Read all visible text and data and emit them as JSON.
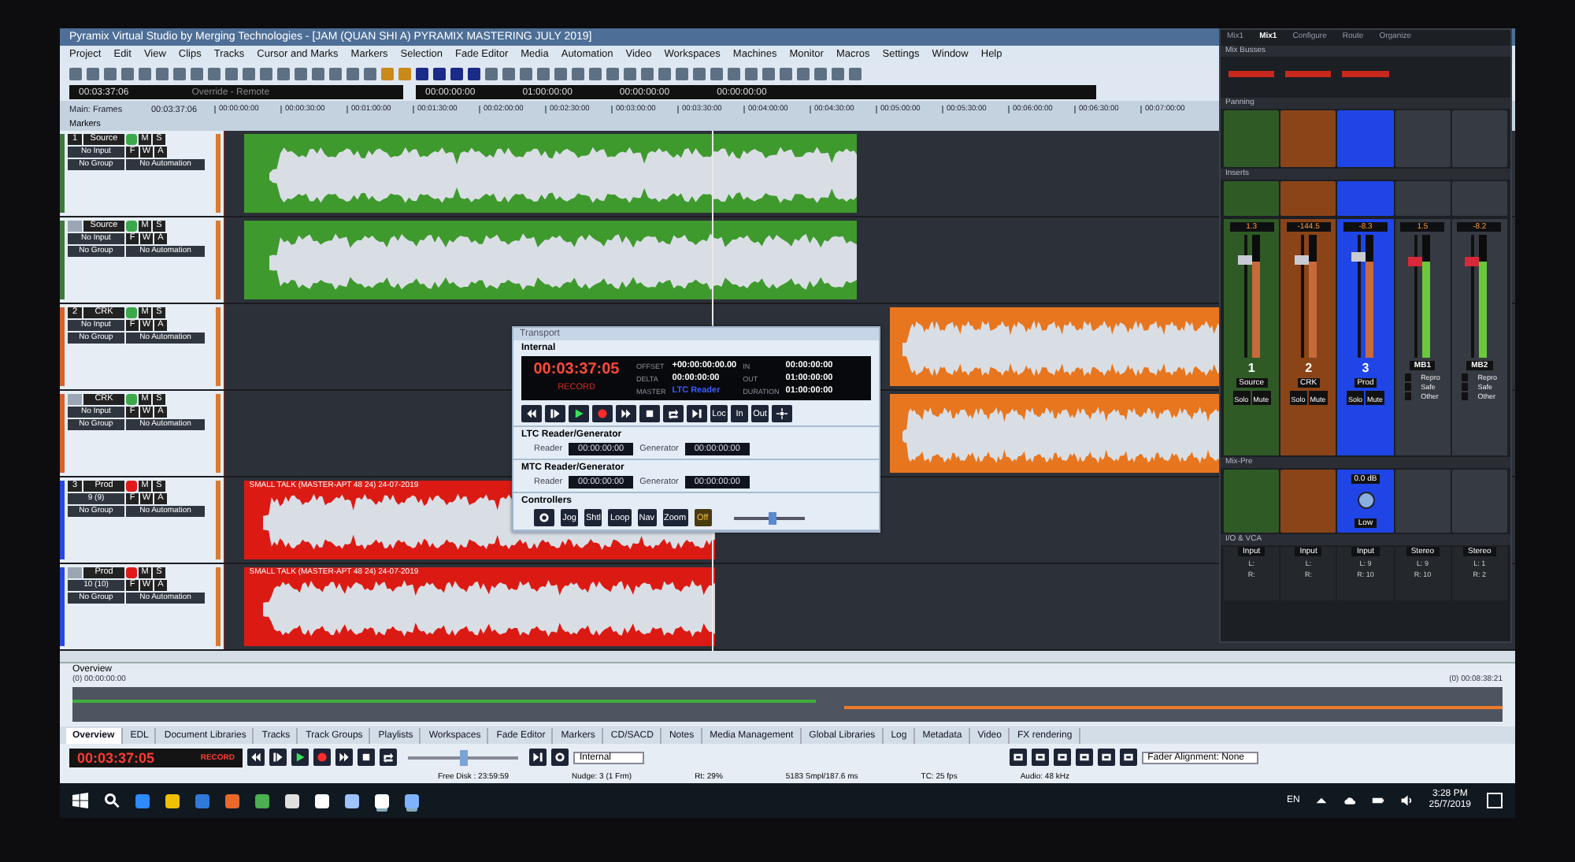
{
  "window": {
    "title": "Pyramix Virtual Studio by Merging Technologies - [JAM (QUAN SHI A) PYRAMIX MASTERING JULY 2019]"
  },
  "menu": [
    "Project",
    "Edit",
    "View",
    "Clips",
    "Tracks",
    "Cursor and Marks",
    "Markers",
    "Selection",
    "Fade Editor",
    "Media",
    "Automation",
    "Video",
    "Workspaces",
    "Machines",
    "Monitor",
    "Macros",
    "Settings",
    "Window",
    "Help"
  ],
  "timecode_bar": {
    "position": "00:03:37:06",
    "mode": "Override - Remote",
    "readouts": [
      "00:00:00:00",
      "01:00:00:00",
      "00:00:00:00",
      "00:00:00:00"
    ]
  },
  "ruler": {
    "label": "Main: Frames",
    "cursor": "00:03:37:06",
    "ticks": [
      "00:00:00:00",
      "00:00:30:00",
      "00:01:00:00",
      "00:01:30:00",
      "00:02:00:00",
      "00:02:30:00",
      "00:03:00:00",
      "00:03:30:00",
      "00:04:00:00",
      "00:04:30:00",
      "00:05:00:00",
      "00:05:30:00",
      "00:06:00:00",
      "00:06:30:00",
      "00:07:00:00"
    ]
  },
  "markers_label": "Markers",
  "tracks": [
    {
      "number": "1",
      "name": "Source",
      "input": "No Input",
      "group": "No Group",
      "automation": "No Automation",
      "record_ready": false,
      "color": "#3d7a3a",
      "buttons": [
        "M",
        "S",
        "F",
        "W",
        "A"
      ],
      "clip": {
        "color": "#3f9a2e"
      }
    },
    {
      "name": "Source",
      "input": "No Input",
      "group": "No Group",
      "automation": "No Automation",
      "record_ready": false,
      "color": "#3d7a3a",
      "buttons": [
        "M",
        "S",
        "F",
        "W",
        "A"
      ],
      "clip": {
        "color": "#3f9a2e"
      }
    },
    {
      "number": "2",
      "name": "CRK",
      "input": "No Input",
      "group": "No Group",
      "automation": "No Automation",
      "record_ready": false,
      "color": "#d8602a",
      "buttons": [
        "M",
        "S",
        "F",
        "W",
        "A"
      ],
      "clip": {
        "color": "#e8761e"
      }
    },
    {
      "name": "CRK",
      "input": "No Input",
      "group": "No Group",
      "automation": "No Automation",
      "record_ready": false,
      "color": "#d8602a",
      "buttons": [
        "M",
        "S",
        "F",
        "W",
        "A"
      ],
      "clip": {
        "color": "#e8761e"
      }
    },
    {
      "number": "3",
      "name": "Prod",
      "input": "9 (9)",
      "group": "No Group",
      "automation": "No Automation",
      "record_ready": true,
      "color": "#2448e0",
      "buttons": [
        "M",
        "S",
        "F",
        "W",
        "A"
      ],
      "clip": {
        "color": "#dc1a14",
        "label": "SMALL TALK (MASTER-APT 48 24) 24-07-2019"
      }
    },
    {
      "name": "Prod",
      "input": "10 (10)",
      "group": "No Group",
      "automation": "No Automation",
      "record_ready": true,
      "color": "#2448e0",
      "buttons": [
        "M",
        "S",
        "F",
        "W",
        "A"
      ],
      "clip": {
        "color": "#dc1a14",
        "label": "SMALL TALK (MASTER-APT 48 24) 24-07-2019"
      }
    }
  ],
  "transport": {
    "title": "Transport",
    "source": "Internal",
    "time": "00:03:37:05",
    "state": "RECORD",
    "fields": [
      {
        "label": "OFFSET",
        "value": "+00:00:00:00.00"
      },
      {
        "label": "IN",
        "value": "00:00:00:00"
      },
      {
        "label": "DELTA",
        "value": "00:00:00:00"
      },
      {
        "label": "OUT",
        "value": "01:00:00:00"
      },
      {
        "label": "MASTER",
        "value": "LTC Reader"
      },
      {
        "label": "DURATION",
        "value": "01:00:00:00"
      }
    ],
    "text_buttons": [
      "Loc",
      "In",
      "Out"
    ],
    "sections": [
      {
        "title": "LTC Reader/Generator",
        "reader_label": "Reader",
        "reader": "00:00:00:00",
        "generator_label": "Generator",
        "generator": "00:00:00:00"
      },
      {
        "title": "MTC Reader/Generator",
        "reader_label": "Reader",
        "reader": "00:00:00:00",
        "generator_label": "Generator",
        "generator": "00:00:00:00"
      }
    ],
    "controllers": {
      "title": "Controllers",
      "buttons": [
        "Jog",
        "Shtl",
        "Loop",
        "Nav",
        "Zoom",
        "Off"
      ],
      "level": 0.55
    }
  },
  "mixer": {
    "tabs": [
      {
        "label": "Mix1",
        "selected": false
      },
      {
        "label": "Mix1",
        "selected": true
      },
      {
        "label": "Configure",
        "selected": false
      },
      {
        "label": "Route",
        "selected": false
      },
      {
        "label": "Organize",
        "selected": false
      }
    ],
    "sections": [
      "Mix Busses",
      "Panning",
      "Inserts",
      "Mix-Pre",
      "I/O & VCA"
    ],
    "strips": [
      {
        "kind": "channel",
        "gain": "1.3",
        "number": "1",
        "name": "Source",
        "color": "#2f5a26",
        "level": 0.8,
        "buttons": [
          "Solo",
          "Mute"
        ],
        "io": [
          "Input",
          "L:",
          "R:"
        ]
      },
      {
        "kind": "channel",
        "gain": "-144.5",
        "number": "2",
        "name": "CRK",
        "color": "#8a4418",
        "level": 0.8,
        "buttons": [
          "Solo",
          "Mute"
        ],
        "io": [
          "Input",
          "L:",
          "R:"
        ]
      },
      {
        "kind": "channel",
        "gain": "-8.3",
        "number": "3",
        "name": "Prod",
        "color": "#1f45e6",
        "level": 0.82,
        "buttons": [
          "Solo",
          "Mute"
        ],
        "io": [
          "Input",
          "L: 9",
          "R: 10"
        ]
      },
      {
        "kind": "bus",
        "gain": "1.5",
        "number": "MB1",
        "color": "#363a42",
        "level": 0.78,
        "buttons": [
          "Repro",
          "Safe",
          "Other"
        ],
        "io": [
          "Stereo",
          "L: 9",
          "R: 10"
        ]
      },
      {
        "kind": "bus",
        "gain": "-8.2",
        "number": "MB2",
        "color": "#363a42",
        "level": 0.78,
        "buttons": [
          "Repro",
          "Safe",
          "Other"
        ],
        "io": [
          "Stereo",
          "L: 1",
          "R: 2"
        ]
      }
    ],
    "pre_gain": "0.0 dB",
    "pre_mode": "Low"
  },
  "overview": {
    "title": "Overview",
    "start": "(0) 00:00:00:00",
    "end": "(0) 00:08:38:21"
  },
  "tabs": [
    {
      "label": "Overview",
      "selected": true
    },
    {
      "label": "EDL",
      "selected": false
    },
    {
      "label": "Document Libraries",
      "selected": false
    },
    {
      "label": "Tracks",
      "selected": false
    },
    {
      "label": "Track Groups",
      "selected": false
    },
    {
      "label": "Playlists",
      "selected": false
    },
    {
      "label": "Workspaces",
      "selected": false
    },
    {
      "label": "Fade Editor",
      "selected": false
    },
    {
      "label": "Markers",
      "selected": false
    },
    {
      "label": "CD/SACD",
      "selected": false
    },
    {
      "label": "Notes",
      "selected": false
    },
    {
      "label": "Media Management",
      "selected": false
    },
    {
      "label": "Global Libraries",
      "selected": false
    },
    {
      "label": "Log",
      "selected": false
    },
    {
      "label": "Metadata",
      "selected": false
    },
    {
      "label": "Video",
      "selected": false
    },
    {
      "label": "FX rendering",
      "selected": false
    }
  ],
  "transport_bar": {
    "time": "00:03:37:05",
    "state": "RECORD",
    "level": 0.5,
    "sync": "Internal",
    "fader_alignment": "Fader Alignment: None"
  },
  "status_bar": [
    "Free Disk : 23:59:59",
    "Nudge: 3 (1 Frm)",
    "Rt: 29%",
    "5183 Smpl/187.6 ms",
    "TC: 25 fps",
    "Audio: 48 kHz"
  ],
  "taskbar": {
    "language": "EN",
    "time": "3:28 PM",
    "date": "25/7/2019"
  }
}
